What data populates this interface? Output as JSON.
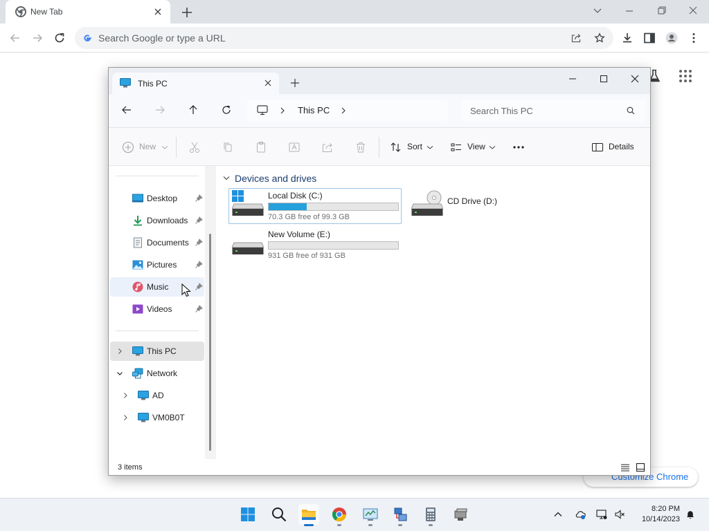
{
  "browser": {
    "tab_title": "New Tab",
    "omnibox_placeholder": "Search Google or type a URL",
    "customize_label": "Customize Chrome"
  },
  "explorer": {
    "tab_title": "This PC",
    "breadcrumb": [
      "This PC"
    ],
    "search_placeholder": "Search This PC",
    "commands": {
      "new": "New",
      "sort": "Sort",
      "view": "View",
      "details": "Details"
    },
    "quick_access": [
      {
        "label": "Desktop",
        "icon": "desktop-folder-icon"
      },
      {
        "label": "Downloads",
        "icon": "downloads-folder-icon"
      },
      {
        "label": "Documents",
        "icon": "documents-folder-icon"
      },
      {
        "label": "Pictures",
        "icon": "pictures-folder-icon"
      },
      {
        "label": "Music",
        "icon": "music-folder-icon"
      },
      {
        "label": "Videos",
        "icon": "videos-folder-icon"
      }
    ],
    "tree": [
      {
        "label": "This PC",
        "icon": "this-pc-icon",
        "state": "collapsed",
        "selected": true
      },
      {
        "label": "Network",
        "icon": "network-icon",
        "state": "expanded"
      },
      {
        "label": "AD",
        "icon": "computer-icon",
        "state": "collapsed"
      },
      {
        "label": "VM0B0T",
        "icon": "computer-icon",
        "state": "collapsed"
      }
    ],
    "group_header": "Devices and drives",
    "drives": [
      {
        "name": "Local Disk (C:)",
        "free_text": "70.3 GB free of 99.3 GB",
        "used_fraction": 0.292,
        "selected": true
      },
      {
        "name": "CD Drive (D:)",
        "free_text": "",
        "used_fraction": null
      },
      {
        "name": "New Volume (E:)",
        "free_text": "931 GB free of 931 GB",
        "used_fraction": 0.0
      }
    ],
    "status_count": "3 items"
  },
  "taskbar": {
    "apps": [
      "start-button",
      "search",
      "file-explorer",
      "chrome",
      "control-panel",
      "network-tool",
      "calculator",
      "app"
    ],
    "time": "8:20 PM",
    "date": "10/14/2023"
  },
  "colors": {
    "accent": "#26a0da",
    "selection_border": "#99c2e8",
    "chrome_link": "#1a73e8"
  }
}
